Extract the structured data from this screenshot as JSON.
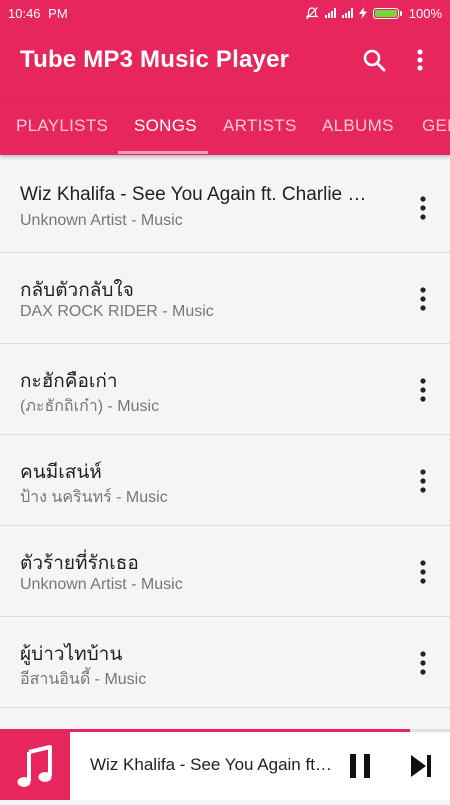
{
  "status_bar": {
    "time": "10:46",
    "ampm": "PM",
    "battery_percent_label": "100%",
    "battery_level": 1.0
  },
  "app_bar": {
    "title": "Tube MP3 Music Player",
    "icons": [
      "search-icon",
      "more-vert-icon"
    ]
  },
  "tabs": [
    {
      "label": "PLAYLISTS",
      "active": false
    },
    {
      "label": "SONGS",
      "active": true
    },
    {
      "label": "ARTISTS",
      "active": false
    },
    {
      "label": "ALBUMS",
      "active": false
    },
    {
      "label": "GEN",
      "active": false
    }
  ],
  "songs": [
    {
      "title": "Wiz Khalifa - See You Again ft. Charlie Puth",
      "subtitle": "Unknown Artist - Music"
    },
    {
      "title": "กลับตัวกลับใจ",
      "subtitle": "DAX ROCK RIDER - Music"
    },
    {
      "title": "กะฮักคือเก่า",
      "subtitle": "(ภะธักถิเก๋า) - Music"
    },
    {
      "title": "คนมีเสน่ห์",
      "subtitle": "ป้าง นครินทร์ - Music"
    },
    {
      "title": "ตัวร้ายที่รักเธอ",
      "subtitle": "Unknown Artist - Music"
    },
    {
      "title": "ผู้บ่าวไทบ้าน",
      "subtitle": "อีสานอินดี้ - Music"
    }
  ],
  "now_playing": {
    "title": "Wiz Khalifa - See You Again ft. Charlie Puth",
    "progress": 0.91,
    "icons": [
      "music-note-icon",
      "pause-icon",
      "skip-next-icon"
    ]
  },
  "colors": {
    "primary": "#e8265e",
    "background": "#f5f5f5"
  }
}
